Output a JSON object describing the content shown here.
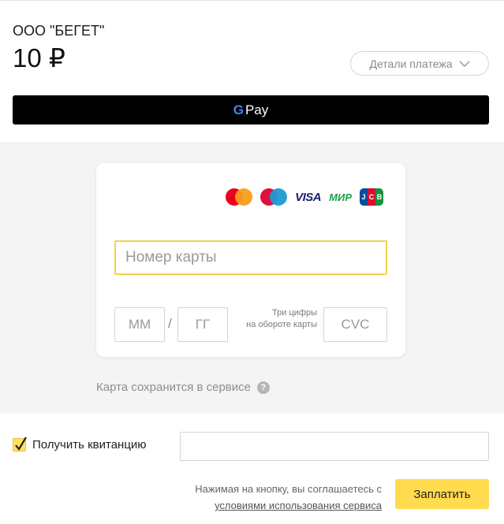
{
  "header": {
    "merchant": "ООО \"БЕГЕТ\"",
    "amount": "10 ₽",
    "details_label": "Детали платежа"
  },
  "gpay": {
    "g_letter": "G",
    "label": "Pay"
  },
  "card_form": {
    "logos": [
      "mastercard",
      "maestro",
      "VISA",
      "МИР",
      "JCB"
    ],
    "visa_text": "VISA",
    "mir_text": "МИР",
    "jcb_letters": [
      "J",
      "C",
      "B"
    ],
    "card_number_placeholder": "Номер карты",
    "month_placeholder": "ММ",
    "slash": "/",
    "year_placeholder": "ГГ",
    "cvc_hint_line1": "Три цифры",
    "cvc_hint_line2": "на обороте карты",
    "cvc_placeholder": "CVC"
  },
  "save_note": {
    "text": "Карта сохранится в сервисе",
    "help": "?"
  },
  "footer": {
    "receipt_label": "Получить квитанцию",
    "receipt_checked": true,
    "terms_text": "Нажимая на кнопку, вы соглашаетесь с",
    "terms_link": "условиями использования сервиса",
    "pay_label": "Заплатить"
  },
  "colors": {
    "accent": "#ffdb4d",
    "focus_border": "#f0d44a",
    "band": "#f4f4f4"
  }
}
